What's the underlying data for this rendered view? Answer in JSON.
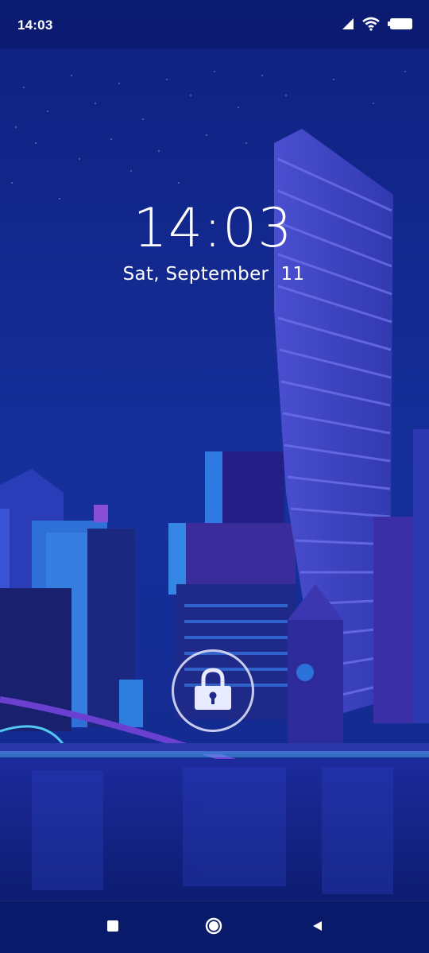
{
  "status_bar": {
    "time": "14:03",
    "icons": [
      "signal-icon",
      "wifi-icon",
      "battery-icon"
    ]
  },
  "lockscreen": {
    "time": "14:03",
    "date": "Sat, September  11",
    "lock_icon": "padlock-icon"
  },
  "navigation": {
    "buttons": [
      "recents-square-icon",
      "home-circle-icon",
      "back-triangle-icon"
    ]
  },
  "colors": {
    "background": "#132a8c",
    "text": "#ffffff",
    "accent_tower": "#3f45c8"
  }
}
